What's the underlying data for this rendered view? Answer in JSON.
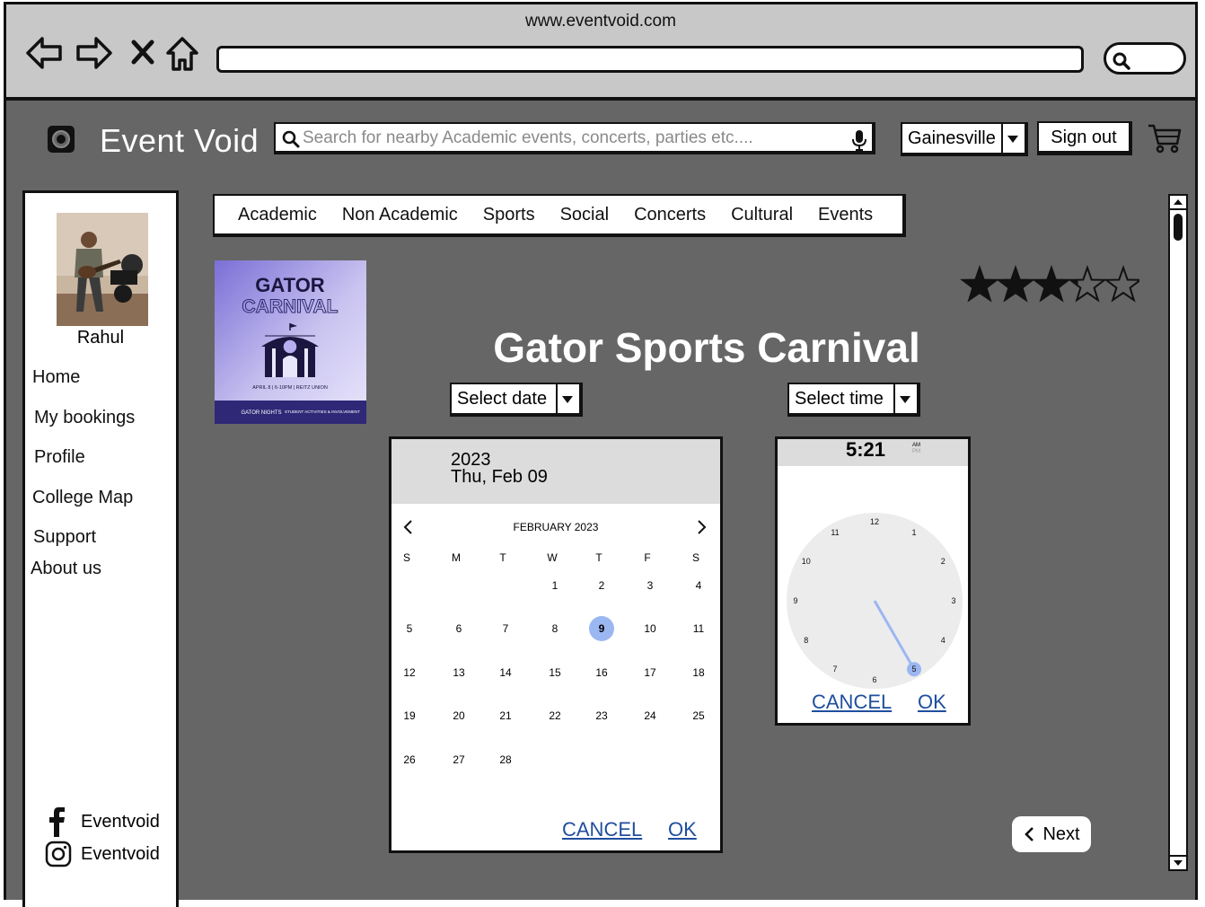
{
  "browser": {
    "url": "www.eventvoid.com"
  },
  "header": {
    "brand": "Event Void",
    "search_placeholder": "Search for nearby Academic events, concerts, parties etc....",
    "city": "Gainesville",
    "sign_out": "Sign out"
  },
  "sidebar": {
    "user_name": "Rahul",
    "links": [
      "Home",
      "My bookings",
      "Profile",
      "College Map",
      "Support",
      "About us"
    ],
    "social": {
      "facebook": "Eventvoid",
      "instagram": "Eventvoid"
    }
  },
  "categories": [
    "Academic",
    "Non Academic",
    "Sports",
    "Social",
    "Concerts",
    "Cultural",
    "Events"
  ],
  "poster": {
    "title_line1": "GATOR",
    "title_line2": "CARNIVAL",
    "info": "APRIL 8 | 6-10PM | REITZ UNION",
    "footer_left": "GATOR NIGHTS",
    "footer_right": "STUDENT ACTIVITIES & INVOLVEMENT"
  },
  "event": {
    "title": "Gator Sports Carnival",
    "rating": 3.5,
    "rating_max": 5,
    "select_date": "Select date",
    "select_time": "Select time"
  },
  "date_picker": {
    "year": "2023",
    "date_label": "Thu, Feb 09",
    "month_label": "FEBRUARY 2023",
    "weekdays": [
      "S",
      "M",
      "T",
      "W",
      "T",
      "F",
      "S"
    ],
    "days": [
      "1",
      "2",
      "3",
      "4",
      "5",
      "6",
      "7",
      "8",
      "9",
      "10",
      "11",
      "12",
      "13",
      "14",
      "15",
      "16",
      "17",
      "18",
      "19",
      "20",
      "21",
      "22",
      "23",
      "24",
      "25",
      "26",
      "27",
      "28"
    ],
    "first_weekday": 3,
    "selected_day": "9",
    "cancel": "CANCEL",
    "ok": "OK"
  },
  "time_picker": {
    "time": "5:21",
    "am": "AM",
    "pm": "PM",
    "hours": [
      "12",
      "1",
      "2",
      "3",
      "4",
      "5",
      "6",
      "7",
      "8",
      "9",
      "10",
      "11"
    ],
    "selected_hour": "5",
    "cancel": "CANCEL",
    "ok": "OK"
  },
  "next_label": "Next",
  "colors": {
    "app_bg": "#666666",
    "accent": "#9bb7f2",
    "link": "#1f4e9e",
    "poster": "#8d7fd9"
  }
}
